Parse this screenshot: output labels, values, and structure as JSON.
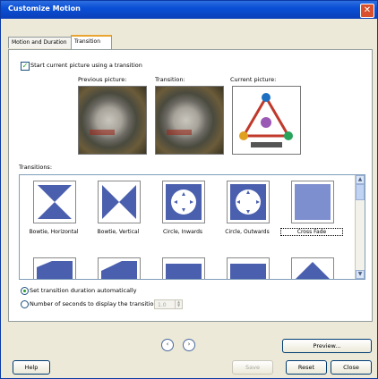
{
  "window": {
    "title": "Customize Motion"
  },
  "tabs": [
    {
      "label": "Motion and Duration"
    },
    {
      "label": "Transition"
    }
  ],
  "transition_panel": {
    "start_checkbox_label": "Start current picture using a transition",
    "start_checked": true,
    "previous_label": "Previous picture:",
    "transition_label": "Transition:",
    "current_label": "Current picture:",
    "transitions_label": "Transitions:",
    "items_row1": [
      {
        "label": "Bowtie, Horizontal",
        "icon": "bowtie-horizontal-icon"
      },
      {
        "label": "Bowtie, Vertical",
        "icon": "bowtie-vertical-icon"
      },
      {
        "label": "Circle, Inwards",
        "icon": "circle-inwards-icon"
      },
      {
        "label": "Circle, Outwards",
        "icon": "circle-outwards-icon"
      },
      {
        "label": "Cross Fade",
        "icon": "cross-fade-icon",
        "selected": true
      }
    ],
    "auto_duration_label": "Set transition duration automatically",
    "seconds_label": "Number of seconds to display the transition:",
    "seconds_value": "1.0"
  },
  "buttons": {
    "preview": "Preview...",
    "help": "Help",
    "save": "Save",
    "reset": "Reset",
    "close": "Close",
    "prev_arrow": "‹",
    "next_arrow": "›"
  },
  "colors": {
    "accent": "#4a5fae",
    "title_bar": "#0a4fd6"
  }
}
